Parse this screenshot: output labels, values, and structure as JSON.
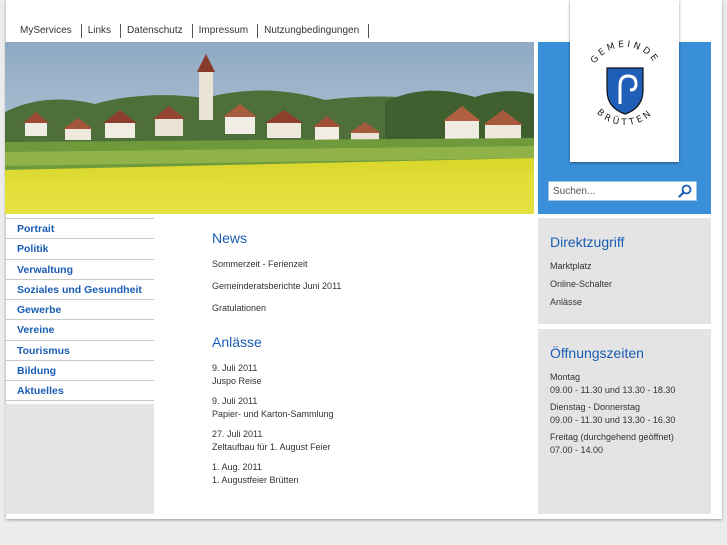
{
  "topnav": [
    "MyServices",
    "Links",
    "Datenschutz",
    "Impressum",
    "Nutzungbedingungen"
  ],
  "logo": {
    "top_text": "GEMEINDE",
    "bottom_text": "BRÜTTEN"
  },
  "search": {
    "placeholder": "Suchen..."
  },
  "leftnav": [
    "Portrait",
    "Politik",
    "Verwaltung",
    "Soziales und Gesundheit",
    "Gewerbe",
    "Vereine",
    "Tourismus",
    "Bildung",
    "Aktuelles"
  ],
  "news": {
    "title": "News",
    "items": [
      "Sommerzeit - Ferienzeit",
      "Gemeinderatsberichte Juni 2011",
      "Gratulationen"
    ]
  },
  "anlaesse": {
    "title": "Anlässe",
    "items": [
      {
        "date": "9. Juli 2011",
        "name": "Juspo Reise"
      },
      {
        "date": "9. Juli 2011",
        "name": "Papier- und Karton-Sammlung"
      },
      {
        "date": "27. Juli 2011",
        "name": "Zeltaufbau für 1. August Feier"
      },
      {
        "date": "1. Aug. 2011",
        "name": "1. Augustfeier Brütten"
      }
    ]
  },
  "direktzugriff": {
    "title": "Direktzugriff",
    "links": [
      "Marktplatz",
      "Online-Schalter",
      "Anlässe"
    ]
  },
  "oeffnungszeiten": {
    "title": "Öffnungszeiten",
    "entries": [
      {
        "day": "Montag",
        "hours": "09.00 - 11.30 und 13.30 - 18.30"
      },
      {
        "day": "Dienstag - Donnerstag",
        "hours": "09.00 - 11.30 und 13.30 - 16.30"
      },
      {
        "day": "Freitag (durchgehend geöffnet)",
        "hours": "07.00 - 14.00"
      }
    ]
  },
  "colors": {
    "accent": "#1a5db4",
    "panel_blue": "#3a8fd9",
    "box_grey": "#e4e4e4"
  }
}
